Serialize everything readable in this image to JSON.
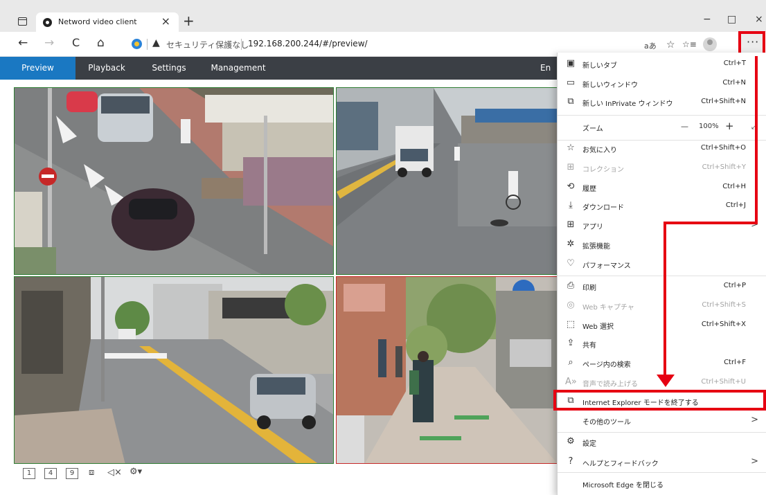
{
  "browser": {
    "tab_title": "Netword video client",
    "tab_close": "×",
    "new_tab": "+",
    "win_minimize": "−",
    "win_maximize": "□",
    "win_close": "×",
    "nav_back": "←",
    "nav_forward": "→",
    "nav_reload": "C",
    "nav_home": "⌂",
    "warning_icon": "▲",
    "warning_text": "セキュリティ保護なし",
    "url": "192.168.200.244/#/preview/",
    "read_aloud": "aあ",
    "favorite_star": "☆",
    "favorites_list": "☆≡",
    "more_label": "···"
  },
  "app_nav": {
    "items": [
      "Preview",
      "Playback",
      "Settings",
      "Management"
    ],
    "active": "Preview",
    "language_fragment": "En"
  },
  "video_toolbar": {
    "layout_1": "1",
    "layout_4": "4",
    "layout_9": "9",
    "snapshot_icon": "image-icon",
    "mute_icon": "speaker-mute-icon",
    "ptz_icon": "ptz-icon"
  },
  "menu": {
    "new_tab": {
      "label": "新しいタブ",
      "shortcut": "Ctrl+T"
    },
    "new_window": {
      "label": "新しいウィンドウ",
      "shortcut": "Ctrl+N"
    },
    "new_inprivate": {
      "label": "新しい InPrivate ウィンドウ",
      "shortcut": "Ctrl+Shift+N"
    },
    "zoom": {
      "label": "ズーム",
      "value": "100%",
      "minus": "—",
      "plus": "+",
      "fullscreen": "⤢"
    },
    "favorites": {
      "label": "お気に入り",
      "shortcut": "Ctrl+Shift+O"
    },
    "collections": {
      "label": "コレクション",
      "shortcut": "Ctrl+Shift+Y"
    },
    "history": {
      "label": "履歴",
      "shortcut": "Ctrl+H"
    },
    "downloads": {
      "label": "ダウンロード",
      "shortcut": "Ctrl+J"
    },
    "apps": {
      "label": "アプリ",
      "chevron": ">"
    },
    "extensions": {
      "label": "拡張機能"
    },
    "performance": {
      "label": "パフォーマンス"
    },
    "print": {
      "label": "印刷",
      "shortcut": "Ctrl+P"
    },
    "web_capture": {
      "label": "Web キャプチャ",
      "shortcut": "Ctrl+Shift+S"
    },
    "web_select": {
      "label": "Web 選択",
      "shortcut": "Ctrl+Shift+X"
    },
    "share": {
      "label": "共有"
    },
    "find": {
      "label": "ページ内の検索",
      "shortcut": "Ctrl+F"
    },
    "read_aloud": {
      "label": "音声で読み上げる",
      "shortcut": "Ctrl+Shift+U"
    },
    "exit_ie_mode": {
      "label": "Internet Explorer モードを終了する"
    },
    "more_tools": {
      "label": "その他のツール",
      "chevron": ">"
    },
    "settings": {
      "label": "設定"
    },
    "help": {
      "label": "ヘルプとフィードバック",
      "chevron": ">"
    },
    "close_edge": {
      "label": "Microsoft Edge を閉じる"
    }
  },
  "colors": {
    "highlight_red": "#e60012",
    "nav_bg": "#3b3f45",
    "nav_active": "#1a78c2"
  }
}
